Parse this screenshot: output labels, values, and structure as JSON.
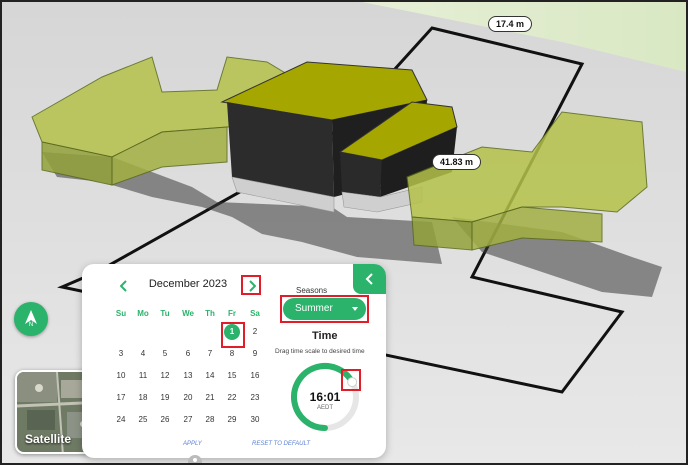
{
  "measurements": {
    "top_edge": "17.4 m",
    "side_edge": "41.83 m"
  },
  "compass": {
    "label": "N"
  },
  "satellite": {
    "label": "Satellite"
  },
  "calendar": {
    "month_title": "December 2023",
    "weekdays": [
      "Su",
      "Mo",
      "Tu",
      "We",
      "Th",
      "Fr",
      "Sa"
    ],
    "weeks": [
      [
        "",
        "",
        "",
        "",
        "",
        "1",
        "2"
      ],
      [
        "3",
        "4",
        "5",
        "6",
        "7",
        "8",
        "9"
      ],
      [
        "10",
        "11",
        "12",
        "13",
        "14",
        "15",
        "16"
      ],
      [
        "17",
        "18",
        "19",
        "20",
        "21",
        "22",
        "23"
      ],
      [
        "24",
        "25",
        "26",
        "27",
        "28",
        "29",
        "30"
      ]
    ],
    "selected_day": "1",
    "apply_label": "APPLY",
    "reset_label": "RESET TO DEFAULT"
  },
  "seasons": {
    "label": "Seasons",
    "selected": "Summer"
  },
  "time": {
    "title": "Time",
    "hint": "Drag time scale to desired time",
    "value": "16:01",
    "timezone": "AEDT",
    "dial_progress": 0.67
  },
  "colors": {
    "accent": "#2bb36b",
    "highlight": "#e11d2a",
    "roof": "#a6a600",
    "building_light": "#9aa83a"
  }
}
